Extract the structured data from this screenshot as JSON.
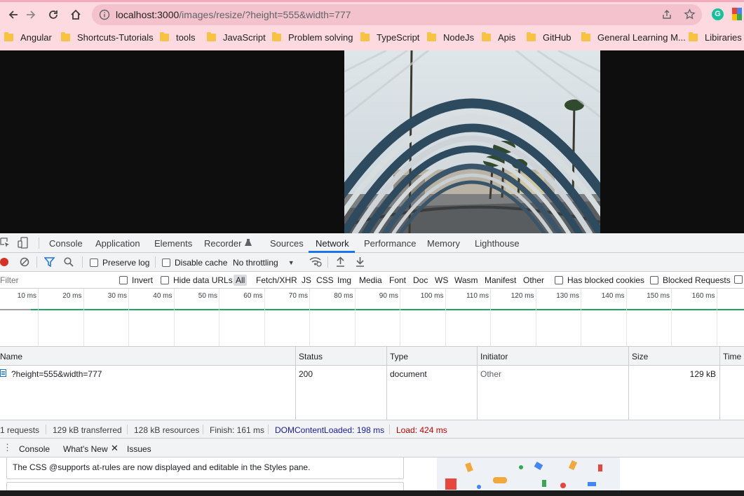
{
  "browser": {
    "url_host": "localhost:3000",
    "url_path": "/images/resize/?height=555&width=777",
    "nav_icons": [
      "back-icon",
      "forward-icon",
      "reload-icon",
      "home-icon"
    ],
    "right_icons": [
      "share-icon",
      "star-icon",
      "grammarly-icon",
      "extension-icon"
    ],
    "bookmarks": [
      "Angular",
      "Shortcuts-Tutorials",
      "tools",
      "JavaScript",
      "Problem solving",
      "TypeScript",
      "NodeJs",
      "Apis",
      "GitHub",
      "General Learning M...",
      "Libiraries"
    ]
  },
  "devtools": {
    "tabs": [
      "Console",
      "Application",
      "Elements",
      "Recorder",
      "Sources",
      "Network",
      "Performance",
      "Memory",
      "Lighthouse"
    ],
    "active_tab": "Network",
    "toolbar": {
      "preserve_log": "Preserve log",
      "disable_cache": "Disable cache",
      "throttling": "No throttling"
    },
    "filter": {
      "placeholder": "Filter",
      "invert": "Invert",
      "hide_data_urls": "Hide data URLs",
      "types": [
        "All",
        "Fetch/XHR",
        "JS",
        "CSS",
        "Img",
        "Media",
        "Font",
        "Doc",
        "WS",
        "Wasm",
        "Manifest",
        "Other"
      ],
      "has_blocked_cookies": "Has blocked cookies",
      "blocked_requests": "Blocked Requests"
    },
    "timeline_ticks": [
      "10 ms",
      "20 ms",
      "30 ms",
      "40 ms",
      "50 ms",
      "60 ms",
      "70 ms",
      "80 ms",
      "90 ms",
      "100 ms",
      "110 ms",
      "120 ms",
      "130 ms",
      "140 ms",
      "150 ms",
      "160 ms",
      "17"
    ],
    "table": {
      "headers": {
        "name": "Name",
        "status": "Status",
        "type": "Type",
        "initiator": "Initiator",
        "size": "Size",
        "time": "Time"
      },
      "rows": [
        {
          "name": "?height=555&width=777",
          "status": "200",
          "type": "document",
          "initiator": "Other",
          "size": "129 kB"
        }
      ]
    },
    "status": {
      "requests": "1 requests",
      "transferred": "129 kB transferred",
      "resources": "128 kB resources",
      "finish": "Finish: 161 ms",
      "dcl": "DOMContentLoaded: 198 ms",
      "load": "Load: 424 ms"
    },
    "drawer": {
      "tabs": [
        "Console",
        "What's New",
        "Issues"
      ],
      "card_text": "The CSS @supports at-rules are now displayed and editable in the Styles pane."
    }
  },
  "colors": {
    "accent": "#1a73e8",
    "dcl": "#1a1aa6",
    "load": "#c80000",
    "chrome": "#fdd9e0"
  }
}
